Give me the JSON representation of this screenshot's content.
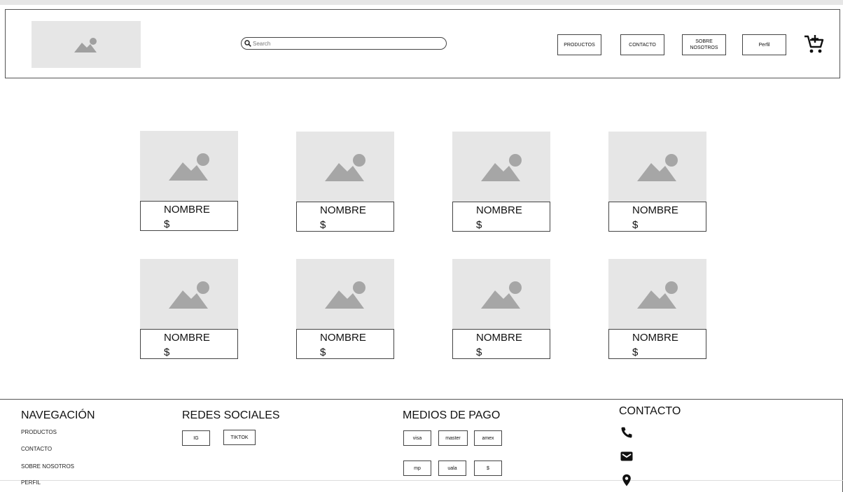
{
  "header": {
    "search_placeholder": "Search",
    "nav": [
      {
        "label": "PRODUCTOS"
      },
      {
        "label": "CONTACTO"
      },
      {
        "label": "SOBRE NOSOTROS"
      },
      {
        "label": "Perfil"
      }
    ]
  },
  "products": [
    {
      "name": "NOMBRE",
      "price": "$"
    },
    {
      "name": "NOMBRE",
      "price": "$"
    },
    {
      "name": "NOMBRE",
      "price": "$"
    },
    {
      "name": "NOMBRE",
      "price": "$"
    },
    {
      "name": "NOMBRE",
      "price": "$"
    },
    {
      "name": "NOMBRE",
      "price": "$"
    },
    {
      "name": "NOMBRE",
      "price": "$"
    },
    {
      "name": "NOMBRE",
      "price": "$"
    }
  ],
  "footer": {
    "navegacion": {
      "title": "NAVEGACIÓN",
      "links": [
        "PRODUCTOS",
        "CONTACTO",
        "SOBRE NOSOTROS",
        "PERFIL"
      ]
    },
    "redes": {
      "title": "REDES SOCIALES",
      "items": [
        "IG",
        "TIKTOK"
      ]
    },
    "pagos": {
      "title": "MEDIOS DE PAGO",
      "items": [
        "visa",
        "master",
        "amex",
        "mp",
        "uala",
        "$"
      ]
    },
    "contacto": {
      "title": "CONTACTO",
      "icons": [
        "phone-icon",
        "mail-icon",
        "location-pin-icon"
      ]
    }
  }
}
